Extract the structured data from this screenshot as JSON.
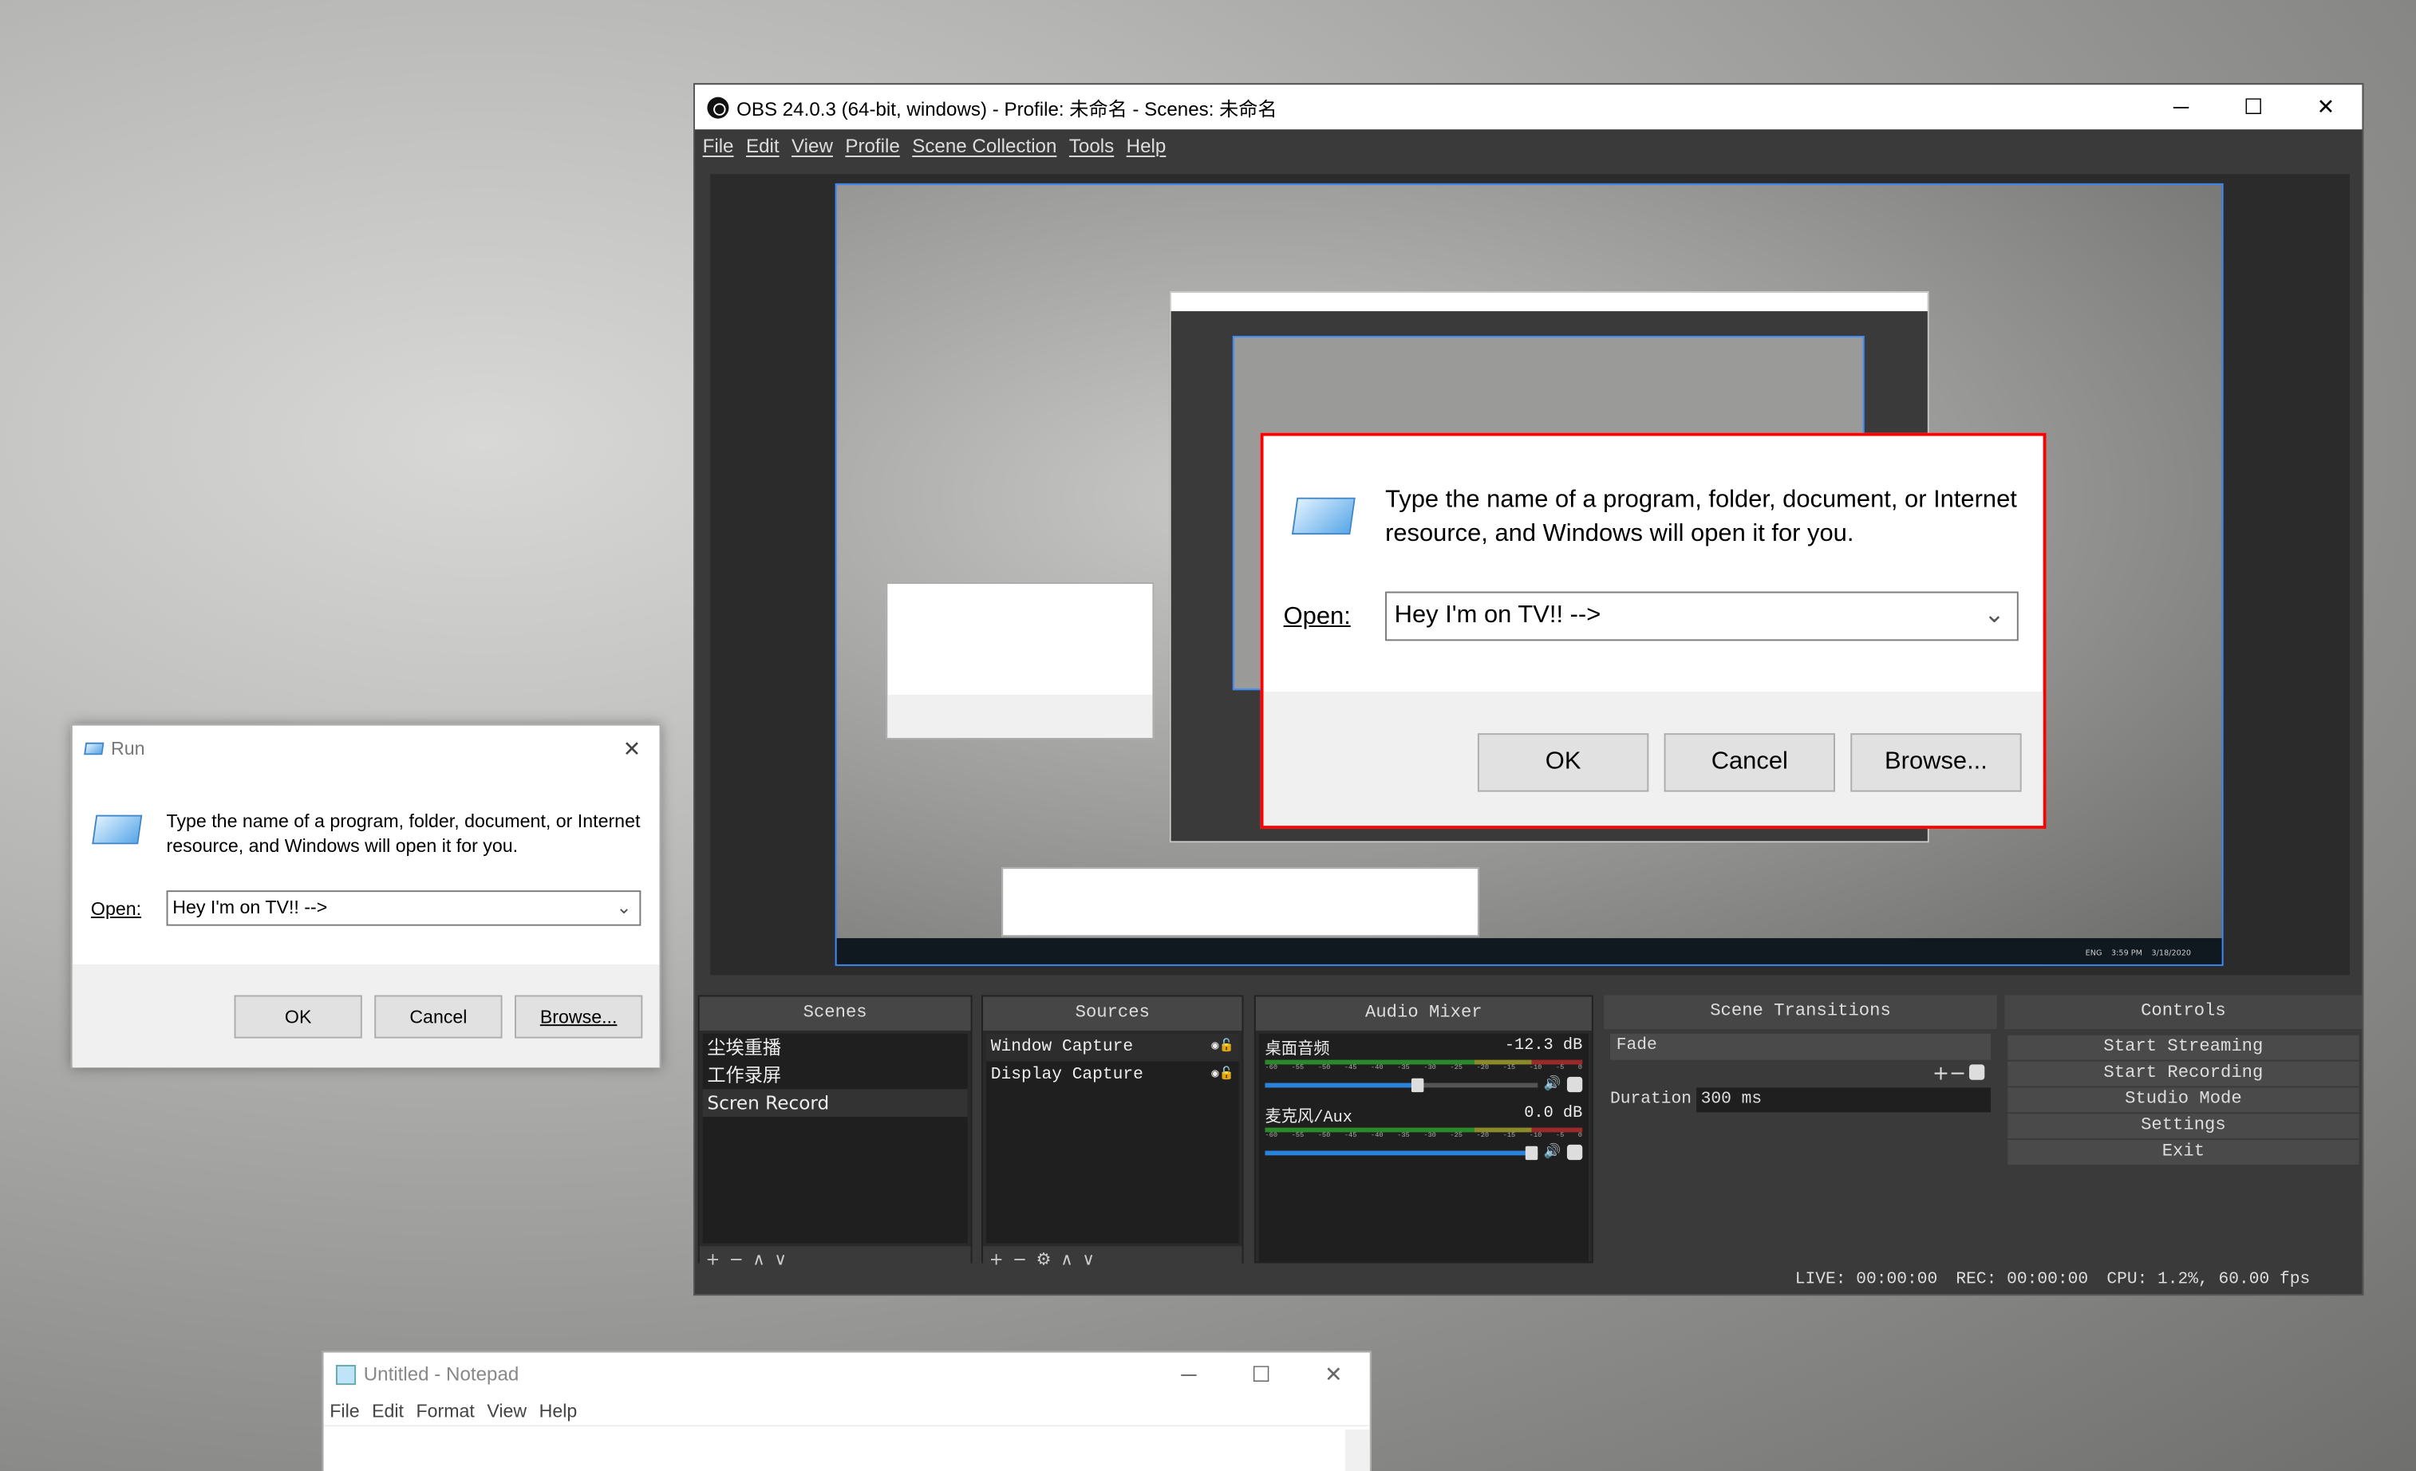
{
  "obs": {
    "title": "OBS 24.0.3 (64-bit, windows) - Profile: 未命名 - Scenes: 未命名",
    "window_controls": {
      "minimize": "─",
      "maximize": "☐",
      "close": "✕"
    },
    "menu": [
      "File",
      "Edit",
      "View",
      "Profile",
      "Scene Collection",
      "Tools",
      "Help"
    ],
    "docks": {
      "scenes": {
        "title": "Scenes",
        "items": [
          "尘埃重播",
          "工作录屏",
          "Scren Record"
        ],
        "selected": 2,
        "toolbar": [
          "+",
          "−",
          "∧",
          "∨"
        ]
      },
      "sources": {
        "title": "Sources",
        "items": [
          "Window Capture",
          "Display Capture"
        ],
        "selected": 0,
        "toolbar": [
          "+",
          "−",
          "⚙",
          "∧",
          "∨"
        ]
      },
      "audio_mixer": {
        "title": "Audio Mixer",
        "tick_labels": [
          "-60",
          "-55",
          "-50",
          "-45",
          "-40",
          "-35",
          "-30",
          "-25",
          "-20",
          "-15",
          "-10",
          "-5",
          "0"
        ],
        "channels": [
          {
            "name": "桌面音频",
            "level": "-12.3 dB",
            "volume_percent": 58
          },
          {
            "name": "麦克风/Aux",
            "level": "0.0 dB",
            "volume_percent": 100
          }
        ]
      },
      "scene_transitions": {
        "title": "Scene Transitions",
        "transition": "Fade",
        "duration_label": "Duration",
        "duration_value": "300 ms",
        "toolbar": [
          "+",
          "−"
        ]
      },
      "controls": {
        "title": "Controls",
        "buttons": [
          "Start Streaming",
          "Start Recording",
          "Studio Mode",
          "Settings",
          "Exit"
        ]
      }
    },
    "status": {
      "live": "LIVE: 00:00:00",
      "rec": "REC: 00:00:00",
      "cpu": "CPU: 1.2%, 60.00 fps"
    },
    "preview": {
      "captured_run": {
        "message": "Type the name of a program, folder, document, or Internet resource, and Windows will open it for you.",
        "open_label": "Open:",
        "value": "Hey I'm on TV!! -->",
        "ok": "OK",
        "cancel": "Cancel",
        "browse": "Browse..."
      },
      "taskbar": {
        "lang": "ENG",
        "time": "3:59 PM",
        "date": "3/18/2020"
      }
    },
    "selection_color": "#ff0000",
    "accent": "#2a82da"
  },
  "run": {
    "title": "Run",
    "message": "Type the name of a program, folder, document, or Internet resource, and Windows will open it for you.",
    "open_label": "Open:",
    "value": "Hey I'm on TV!! -->",
    "ok": "OK",
    "cancel": "Cancel",
    "browse": "Browse..."
  },
  "notepad": {
    "title": "Untitled - Notepad",
    "menu": [
      "File",
      "Edit",
      "Format",
      "View",
      "Help"
    ]
  }
}
